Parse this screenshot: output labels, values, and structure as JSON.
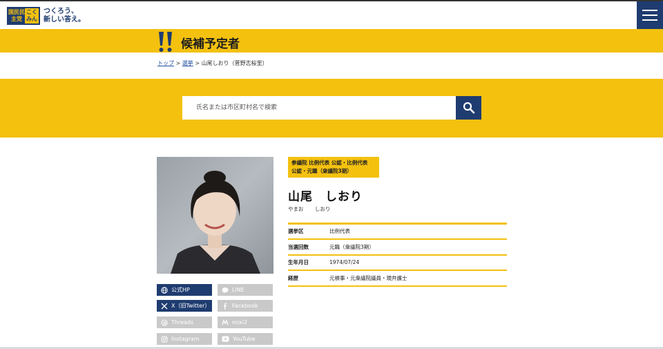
{
  "header": {
    "logo_left": "国民民主党",
    "logo_right": "こくみん",
    "tagline_line1": "つくろう、",
    "tagline_line2": "新しい答え。"
  },
  "title_band": {
    "title": "候補予定者"
  },
  "breadcrumb": {
    "top": "トップ",
    "election": "選挙",
    "current": "山尾しおり（菅野志桜里）",
    "sep": ">"
  },
  "search": {
    "placeholder": "氏名または市区町村名で検索"
  },
  "candidate": {
    "tag_line1": "参議院 比例代表 公認・比例代表",
    "tag_line2": "公認・元職（衆議院3期）",
    "name": "山尾　しおり",
    "kana": "やまお しおり"
  },
  "info": [
    {
      "label": "選挙区",
      "value": "比例代表"
    },
    {
      "label": "当選回数",
      "value": "元職（衆議院3期）"
    },
    {
      "label": "生年月日",
      "value": "1974/07/24"
    },
    {
      "label": "経歴",
      "value": "元検事・元衆議院議員・現弁護士"
    }
  ],
  "links": [
    {
      "label": "公式HP",
      "icon": "globe-icon",
      "active": true
    },
    {
      "label": "LINE",
      "icon": "line-icon",
      "active": false
    },
    {
      "label": "X（旧Twitter）",
      "icon": "x-icon",
      "active": true
    },
    {
      "label": "Facebook",
      "icon": "facebook-icon",
      "active": false
    },
    {
      "label": "Threads",
      "icon": "threads-icon",
      "active": false
    },
    {
      "label": "mixi2",
      "icon": "mixi-icon",
      "active": false
    },
    {
      "label": "Instagram",
      "icon": "instagram-icon",
      "active": false
    },
    {
      "label": "YouTube",
      "icon": "youtube-icon",
      "active": false
    }
  ],
  "colors": {
    "brand_yellow": "#f4c10f",
    "brand_navy": "#1f3c70",
    "disabled_gray": "#c9c9c9"
  }
}
